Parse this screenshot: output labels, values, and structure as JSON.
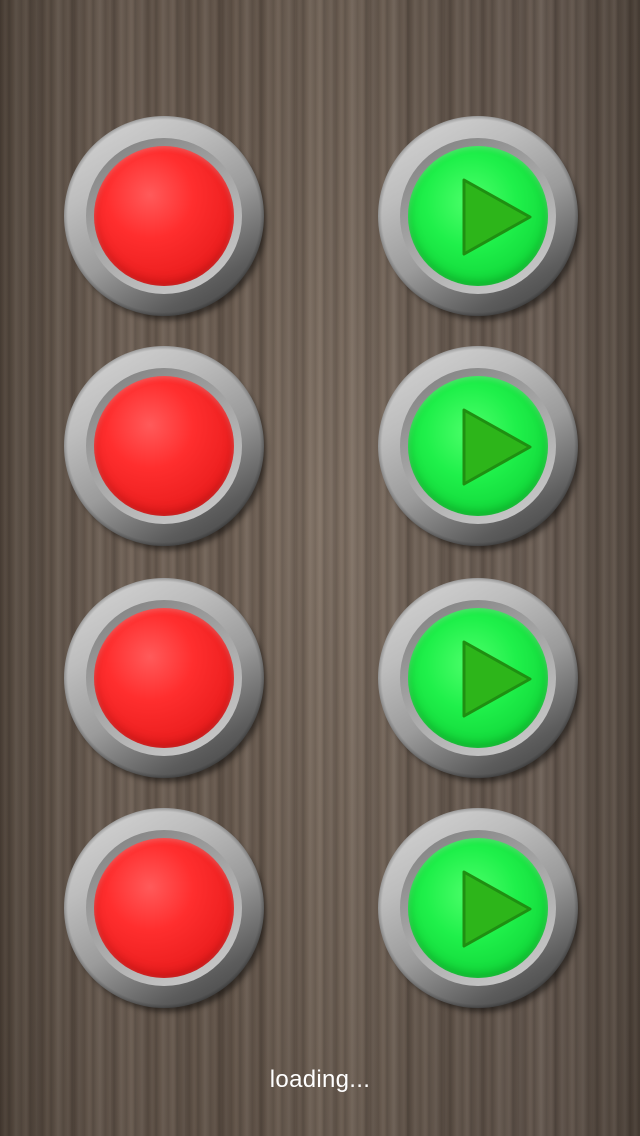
{
  "background": {
    "texture": "wood-grain",
    "color": "#6b5a4a"
  },
  "colors": {
    "record_face": "#ff2e2e",
    "play_face": "#1ff04a",
    "play_triangle": "#2db51a",
    "ring": "#a8a8a8"
  },
  "pads": [
    {
      "record_icon": "record-button",
      "play_icon": "play-icon"
    },
    {
      "record_icon": "record-button",
      "play_icon": "play-icon"
    },
    {
      "record_icon": "record-button",
      "play_icon": "play-icon"
    },
    {
      "record_icon": "record-button",
      "play_icon": "play-icon"
    }
  ],
  "status": {
    "loading_text": "loading..."
  }
}
